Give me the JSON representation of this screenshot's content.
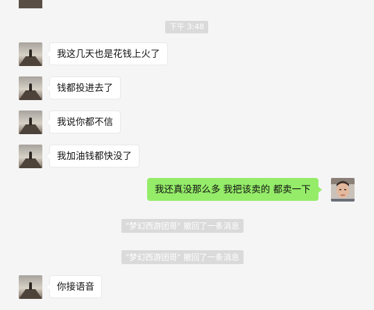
{
  "time_divider": "下午 3:48",
  "messages": [
    {
      "direction": "incoming",
      "text": "我这几天也是花钱上火了"
    },
    {
      "direction": "incoming",
      "text": "钱都投进去了"
    },
    {
      "direction": "incoming",
      "text": "我说你都不信"
    },
    {
      "direction": "incoming",
      "text": "我加油钱都快没了"
    },
    {
      "direction": "outgoing",
      "text": "我还真没那么多  我把该卖的 都卖一下"
    },
    {
      "direction": "system",
      "text": "\"梦幻西游团哥\" 撤回了一条消息"
    },
    {
      "direction": "system",
      "text": "\"梦幻西游团哥\" 撤回了一条消息"
    },
    {
      "direction": "incoming",
      "text": "你接语音"
    }
  ],
  "colors": {
    "background": "#f5f5f5",
    "incoming_bubble": "#ffffff",
    "outgoing_bubble": "#95ec69",
    "system_notice_bg": "#dadada"
  }
}
